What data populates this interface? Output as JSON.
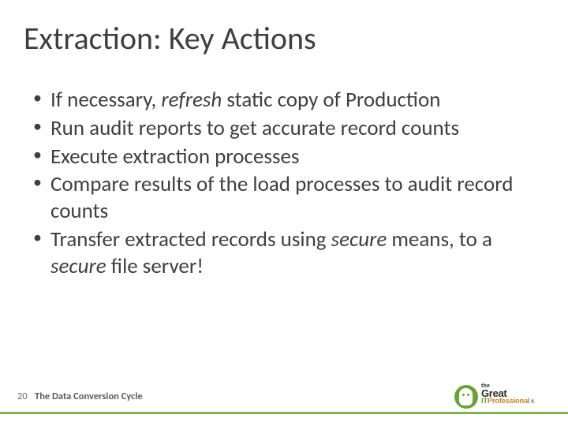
{
  "title": "Extraction: Key Actions",
  "bullets": [
    {
      "pre": "If necessary, ",
      "em": "refresh",
      "post": " static copy of Production"
    },
    {
      "pre": "Run audit reports to get accurate record counts",
      "em": "",
      "post": ""
    },
    {
      "pre": "Execute extraction processes",
      "em": "",
      "post": ""
    },
    {
      "pre": "Compare results of the load processes to audit record counts",
      "em": "",
      "post": ""
    },
    {
      "pre": "Transfer extracted records using ",
      "em": "secure",
      "post": " means, to a ",
      "em2": "secure",
      "post2": " file server!"
    }
  ],
  "footer": {
    "page": "20",
    "title": "The Data Conversion Cycle"
  },
  "logo": {
    "the": "the",
    "great": "Great",
    "it": "IT",
    "pro": "Professional",
    "reg": "®"
  }
}
